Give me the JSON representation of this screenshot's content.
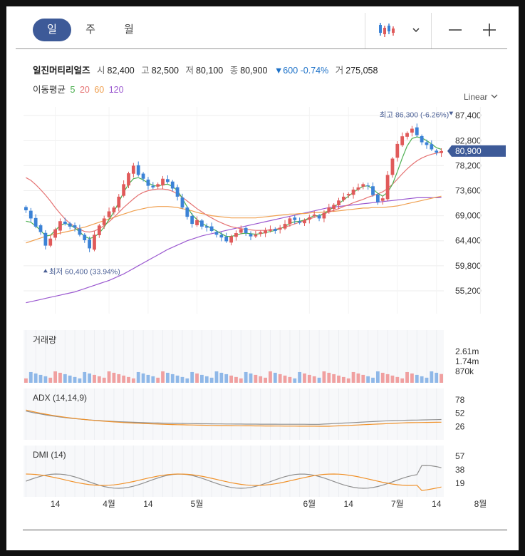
{
  "toolbar": {
    "tabs": [
      {
        "label": "일"
      },
      {
        "label": "주"
      },
      {
        "label": "월"
      }
    ],
    "active_tab": "일",
    "chart_type_icon": "candlestick-icon",
    "dropdown_icon": "chevron-down-icon",
    "zoom_out_icon": "minus-icon",
    "zoom_in_icon": "plus-icon"
  },
  "quote": {
    "name": "일진머티리얼즈",
    "open_label": "시",
    "open": "82,400",
    "high_label": "고",
    "high": "82,500",
    "low_label": "저",
    "low": "80,100",
    "close_label": "종",
    "close": "80,900",
    "change": "▼600 -0.74%",
    "volume_label": "거",
    "volume": "275,058"
  },
  "ma_legend": {
    "label": "이동평균",
    "items": [
      {
        "period": "5",
        "color": "#4caf50"
      },
      {
        "period": "20",
        "color": "#e57373"
      },
      {
        "period": "60",
        "color": "#f0a050"
      },
      {
        "period": "120",
        "color": "#9b59d0"
      }
    ]
  },
  "scale": {
    "label": "Linear"
  },
  "colors": {
    "up": "#e05a5a",
    "down": "#3b82d6",
    "last_price_bg": "#3d5a98",
    "adx": "#909090",
    "adx_signal": "#f0922b"
  },
  "chart_data": [
    {
      "type": "candlestick",
      "yticks": [
        "87,400",
        "82,800",
        "78,200",
        "73,600",
        "69,000",
        "64,400",
        "59,800",
        "55,200"
      ],
      "ylim": [
        51000,
        89000
      ],
      "xticks": [
        {
          "label": "14",
          "index": 6
        },
        {
          "label": "4월",
          "index": 17
        },
        {
          "label": "14",
          "index": 25
        },
        {
          "label": "5월",
          "index": 35
        },
        {
          "label": "6월",
          "index": 58
        },
        {
          "label": "14",
          "index": 66
        },
        {
          "label": "7월",
          "index": 76
        },
        {
          "label": "14",
          "index": 84
        },
        {
          "label": "8월",
          "index": 93
        }
      ],
      "annotations": {
        "max": {
          "label": "최고 86,300 (-6.26%)",
          "value": 86300,
          "index": 87
        },
        "min": {
          "label": "최저 60,400 (33.94%)",
          "value": 60400,
          "index": 4
        },
        "last": {
          "label": "80,900",
          "value": 80900
        }
      },
      "candles_close": [
        70000,
        68500,
        67000,
        66000,
        63500,
        64800,
        66500,
        68000,
        67500,
        67000,
        66800,
        65500,
        64500,
        63000,
        65500,
        67200,
        68500,
        69800,
        70500,
        72500,
        74800,
        76800,
        78200,
        76500,
        75800,
        74500,
        74200,
        74800,
        75800,
        75200,
        74000,
        72500,
        70500,
        68800,
        67500,
        68200,
        67000,
        66800,
        66200,
        65500,
        65000,
        64300,
        65200,
        65800,
        66500,
        65800,
        65200,
        65500,
        66000,
        66300,
        66500,
        66200,
        66800,
        67500,
        68500,
        68200,
        67700,
        68200,
        68700,
        69200,
        68500,
        69500,
        70500,
        71000,
        71800,
        72500,
        73000,
        73800,
        74200,
        74800,
        74500,
        72800,
        71500,
        72200,
        76500,
        79500,
        82200,
        83600,
        84200,
        85000,
        83800,
        82500,
        82000,
        81200,
        80600,
        80900
      ],
      "ma5": [
        68000,
        67800,
        67100,
        66300,
        65300,
        65400,
        66300,
        67200,
        67600,
        67300,
        66800,
        66000,
        65200,
        64800,
        65100,
        65800,
        66900,
        68300,
        69700,
        71500,
        73300,
        74800,
        75800,
        76000,
        75600,
        75000,
        74600,
        74400,
        74700,
        74800,
        74400,
        73600,
        72200,
        70600,
        69200,
        68300,
        67600,
        67100,
        66700,
        66200,
        65700,
        65200,
        65200,
        65400,
        65700,
        65800,
        65700,
        65600,
        65700,
        65900,
        66100,
        66300,
        66600,
        67000,
        67600,
        67900,
        68000,
        68200,
        68600,
        69000,
        69000,
        69400,
        70000,
        70600,
        71200,
        71900,
        72600,
        73300,
        73900,
        74400,
        74500,
        73900,
        73100,
        72600,
        73300,
        74800,
        77100,
        79600,
        81800,
        83200,
        83500,
        83300,
        82800,
        82200,
        81500,
        81200
      ],
      "ma20": [
        76000,
        75500,
        74700,
        73800,
        72800,
        71700,
        70500,
        69400,
        68400,
        67600,
        67000,
        66500,
        66100,
        66000,
        66200,
        66600,
        67200,
        67900,
        68700,
        69600,
        70500,
        71300,
        72100,
        72800,
        73300,
        73600,
        73800,
        73900,
        73900,
        73800,
        73500,
        73000,
        72400,
        71700,
        71000,
        70300,
        69700,
        69100,
        68600,
        68100,
        67700,
        67300,
        67000,
        66800,
        66600,
        66500,
        66400,
        66300,
        66300,
        66300,
        66400,
        66500,
        66700,
        66900,
        67200,
        67500,
        67800,
        68100,
        68400,
        68700,
        69000,
        69300,
        69700,
        70000,
        70300,
        70700,
        71000,
        71400,
        71700,
        72000,
        72400,
        72700,
        73000,
        73400,
        74000,
        74800,
        75700,
        76700,
        77600,
        78400,
        79100,
        79600,
        80000,
        80300,
        80500,
        80700
      ],
      "ma60": [
        64000,
        64300,
        64600,
        64900,
        65200,
        65400,
        65600,
        65800,
        66000,
        66200,
        66400,
        66700,
        66900,
        67200,
        67500,
        67800,
        68100,
        68400,
        68700,
        69000,
        69300,
        69600,
        69900,
        70100,
        70300,
        70500,
        70600,
        70700,
        70700,
        70700,
        70600,
        70500,
        70300,
        70100,
        69900,
        69600,
        69400,
        69200,
        69000,
        68900,
        68800,
        68700,
        68600,
        68600,
        68600,
        68600,
        68600,
        68600,
        68700,
        68800,
        68900,
        69000,
        69100,
        69200,
        69300,
        69300,
        69400,
        69400,
        69500,
        69600,
        69600,
        69700,
        69800,
        69800,
        69900,
        70000,
        70100,
        70200,
        70300,
        70400,
        70400,
        70500,
        70500,
        70500,
        70600,
        70700,
        70800,
        71000,
        71200,
        71400,
        71600,
        71800,
        72000,
        72200,
        72400,
        72600
      ],
      "ma120": [
        53000,
        53200,
        53400,
        53600,
        53800,
        54000,
        54200,
        54400,
        54600,
        54800,
        55000,
        55300,
        55600,
        55900,
        56200,
        56500,
        56800,
        57100,
        57500,
        57900,
        58300,
        58800,
        59300,
        59800,
        60300,
        60800,
        61300,
        61800,
        62300,
        62800,
        63200,
        63600,
        64000,
        64400,
        64700,
        65000,
        65300,
        65500,
        65700,
        65900,
        66100,
        66300,
        66500,
        66700,
        66900,
        67100,
        67300,
        67500,
        67700,
        67900,
        68100,
        68300,
        68500,
        68700,
        68900,
        69100,
        69300,
        69500,
        69700,
        69900,
        70100,
        70300,
        70500,
        70600,
        70700,
        70800,
        70900,
        71000,
        71100,
        71200,
        71300,
        71400,
        71500,
        71600,
        71700,
        71800,
        71900,
        72000,
        72100,
        72200,
        72300,
        72300,
        72300,
        72300,
        72300,
        72300
      ]
    },
    {
      "type": "bar",
      "title": "거래량",
      "yticks": [
        "2.61m",
        "1.74m",
        "870k"
      ],
      "ylim": [
        0,
        3000000
      ],
      "max_value": 2610000
    },
    {
      "type": "line",
      "title": "ADX (14,14,9)",
      "yticks": [
        "78",
        "52",
        "26"
      ],
      "ylim": [
        0,
        100
      ]
    },
    {
      "type": "line",
      "title": "DMI (14)",
      "yticks": [
        "57",
        "38",
        "19"
      ],
      "ylim": [
        0,
        72
      ]
    }
  ]
}
